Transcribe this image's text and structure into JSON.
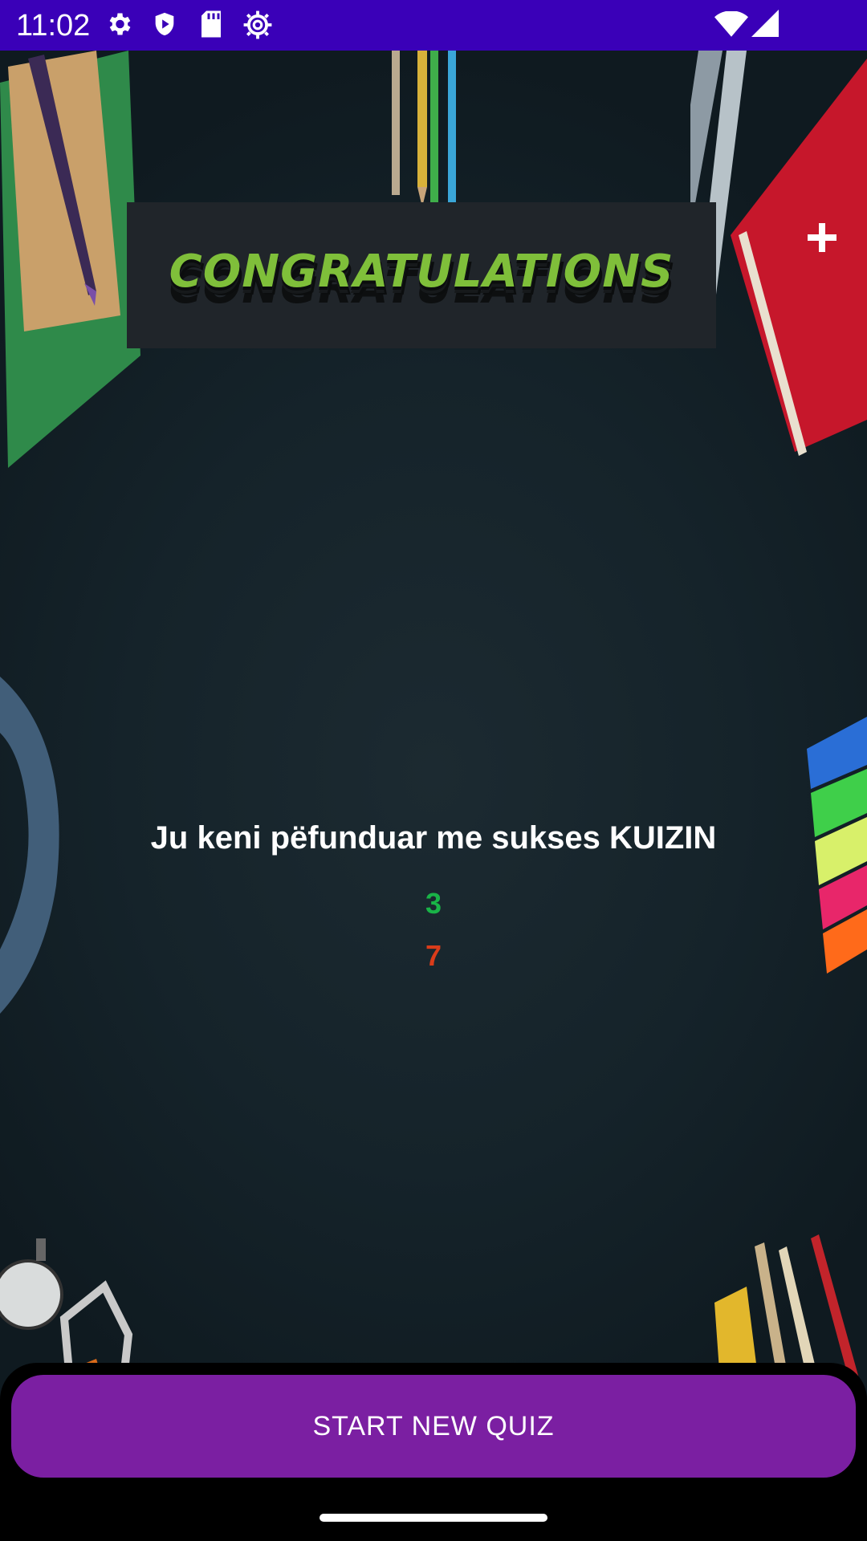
{
  "status_bar": {
    "time": "11:02",
    "icons": [
      "settings-gear-icon",
      "shield-play-icon",
      "sd-card-icon",
      "sun-gear-icon",
      "wifi-icon",
      "cellular-signal-icon"
    ]
  },
  "banner": {
    "title": "CONGRATULATIONS",
    "title_color": "#7fbf3a"
  },
  "result": {
    "message": "Ju keni pëfunduar me sukses KUIZIN",
    "correct_count": "3",
    "wrong_count": "7",
    "correct_color": "#19b347",
    "wrong_color": "#d93c1a"
  },
  "actions": {
    "start_new_quiz_label": "START NEW QUIZ",
    "button_color": "#7b1fa2"
  },
  "colors": {
    "status_bar": "#3a00b8",
    "background": "#15232a"
  }
}
